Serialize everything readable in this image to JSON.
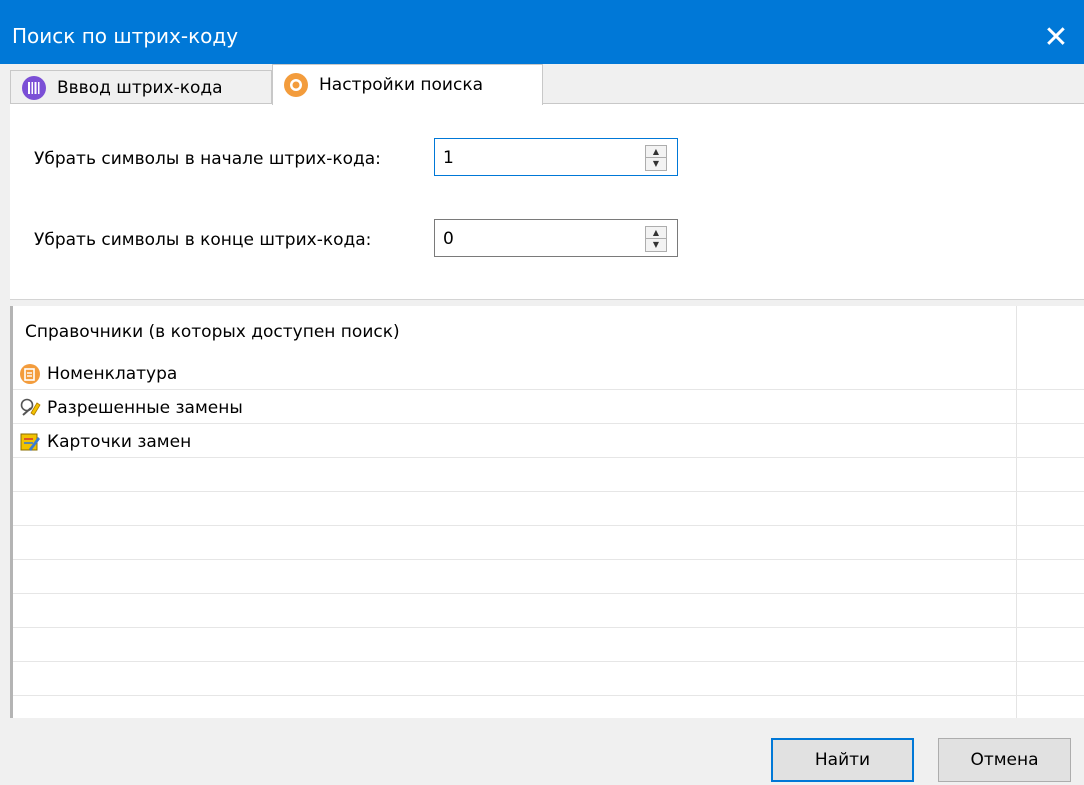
{
  "window": {
    "title": "Поиск по штрих-коду"
  },
  "tabs": [
    {
      "label": "Вввод штрих-кода",
      "icon": "barcode-icon"
    },
    {
      "label": "Настройки поиска",
      "icon": "search-settings-icon"
    }
  ],
  "settings": {
    "trim_start": {
      "label": "Убрать символы в начале штрих-кода:",
      "value": "1"
    },
    "trim_end": {
      "label": "Убрать символы в конце штрих-кода:",
      "value": "0"
    }
  },
  "directories": {
    "header": "Справочники (в которых доступен поиск)",
    "items": [
      {
        "label": "Номенклатура",
        "icon": "nomenclature-icon"
      },
      {
        "label": "Разрешенные замены",
        "icon": "allowed-replacements-icon"
      },
      {
        "label": "Карточки замен",
        "icon": "replacement-cards-icon"
      }
    ]
  },
  "buttons": {
    "find": "Найти",
    "cancel": "Отмена"
  },
  "colors": {
    "titlebar": "#0078d7",
    "tab_active": "#ffffff",
    "accent_orange": "#f39c3c",
    "accent_purple": "#7b4fd6"
  }
}
